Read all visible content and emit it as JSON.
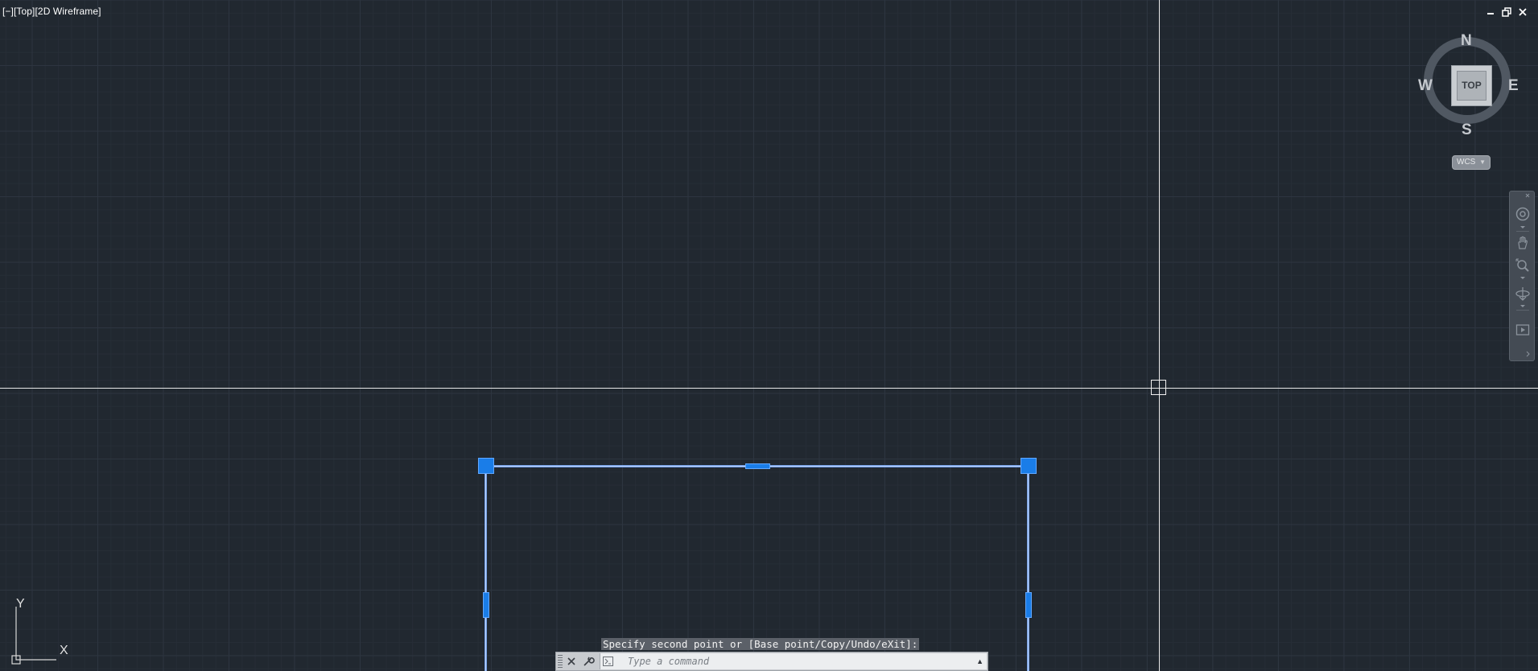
{
  "viewport": {
    "label": "[−][Top][2D Wireframe]",
    "controls": {
      "minimize_icon": "minimize-icon",
      "restore_icon": "restore-icon",
      "close_icon": "close-icon"
    }
  },
  "viewcube": {
    "north": "N",
    "south": "S",
    "west": "W",
    "east": "E",
    "face": "TOP",
    "ucs_menu": "WCS"
  },
  "navbar": {
    "tools": [
      "steering-wheel-icon",
      "pan-icon",
      "zoom-extents-icon",
      "orbit-icon",
      "showmotion-icon"
    ]
  },
  "ucs_icon": {
    "x_label": "X",
    "y_label": "Y"
  },
  "command_line": {
    "prompt": "Specify second point or [Base point/Copy/Undo/eXit]:",
    "placeholder": "Type a command"
  },
  "colors": {
    "background": "#212830",
    "selection": "#1a7de8",
    "crosshair": "#e8e8e8"
  }
}
